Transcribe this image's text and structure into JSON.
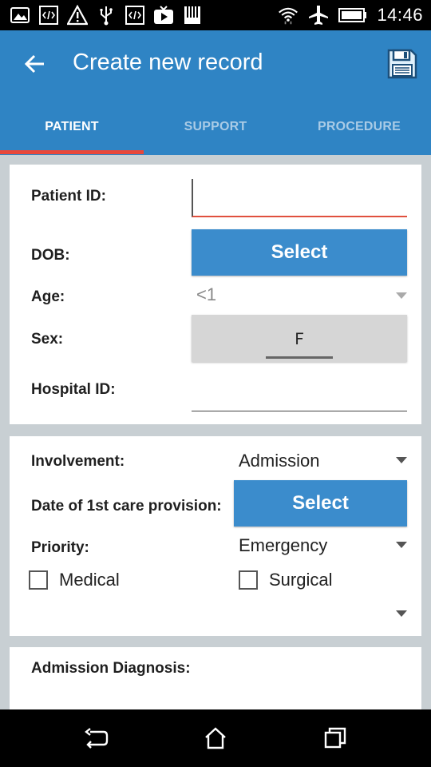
{
  "status_bar": {
    "time": "14:46",
    "icons": [
      "gallery-icon",
      "code-icon",
      "warning-icon",
      "usb-icon",
      "code-icon",
      "video-icon",
      "sdcard-icon",
      "wifi-icon",
      "airplane-icon",
      "battery-icon"
    ]
  },
  "app_bar": {
    "title": "Create new record",
    "back_icon": "arrow-left-icon",
    "save_icon": "save-icon"
  },
  "tabs": [
    {
      "label": "PATIENT",
      "active": true
    },
    {
      "label": "SUPPORT",
      "active": false
    },
    {
      "label": "PROCEDURE",
      "active": false
    }
  ],
  "patient_card": {
    "patient_id_label": "Patient ID:",
    "patient_id_value": "",
    "dob_label": "DOB:",
    "dob_button": "Select",
    "age_label": "Age:",
    "age_value": "<1",
    "sex_label": "Sex:",
    "sex_value": "F",
    "hospital_id_label": "Hospital ID:",
    "hospital_id_value": ""
  },
  "care_card": {
    "involvement_label": "Involvement:",
    "involvement_value": "Admission",
    "care_date_label": "Date of 1st care provision:",
    "care_date_button": "Select",
    "priority_label": "Priority:",
    "priority_value": "Emergency",
    "checkboxes": [
      {
        "label": "Medical",
        "checked": false
      },
      {
        "label": "Surgical",
        "checked": false
      }
    ]
  },
  "diagnosis_card": {
    "admission_diagnosis_label": "Admission Diagnosis:"
  },
  "colors": {
    "primary": "#2f84c4",
    "button": "#3b8ccc",
    "accent": "#e8473a",
    "background": "#c8cfd3"
  }
}
